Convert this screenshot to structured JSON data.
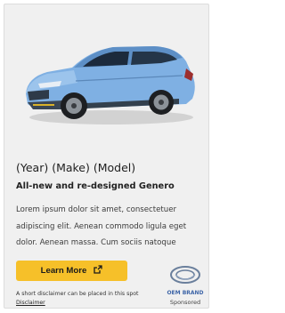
{
  "ad": {
    "title": "(Year) (Make) (Model)",
    "subtitle": "All-new and re-designed Genero",
    "body": "Lorem ipsum dolor sit amet, consectetuer adipiscing elit. Aenean commodo ligula eget dolor. Aenean massa. Cum sociis natoque",
    "cta_label": "Learn More",
    "disclaimer_text": "A short disclaimer can be placed in this spot",
    "disclaimer_link": "Disclaimer",
    "brand_name": "OEM BRAND",
    "sponsored_label": "Sponsored"
  },
  "colors": {
    "card_bg": "#f0f0f0",
    "cta_bg": "#f6c029",
    "car_body": "#7fb0e3",
    "brand_blue": "#3f66a8"
  },
  "icons": {
    "cta_icon": "external-link-icon",
    "brand_logo": "oem-brand-logo"
  }
}
